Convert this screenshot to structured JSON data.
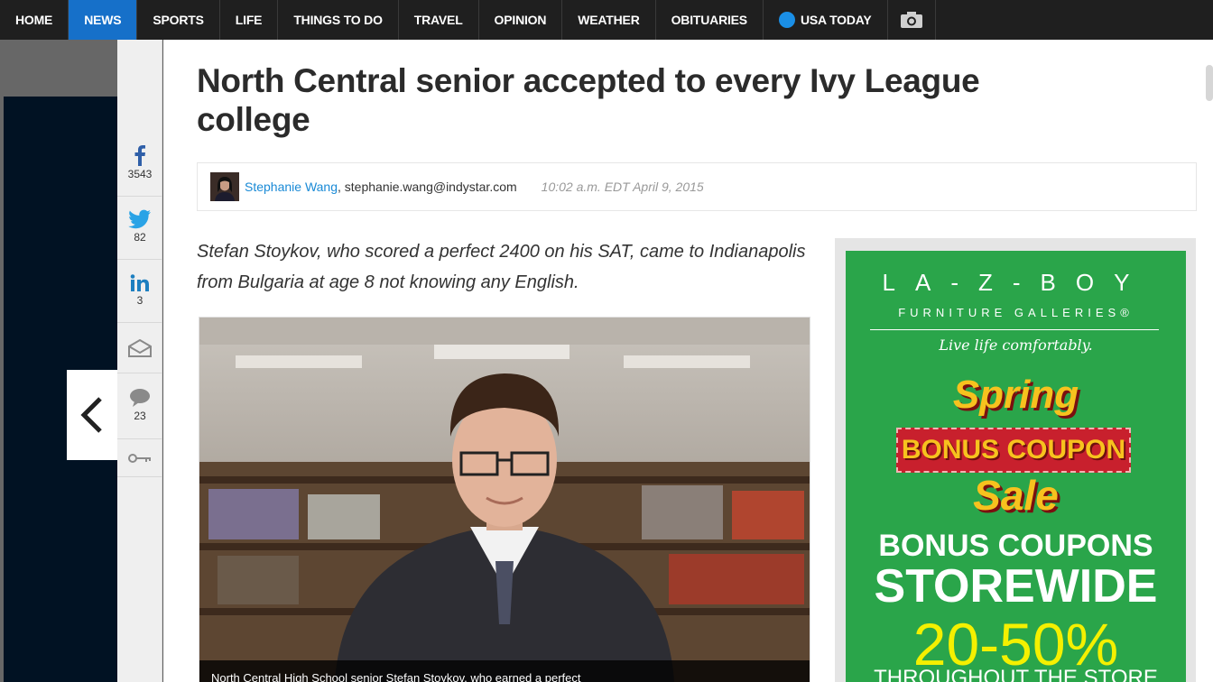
{
  "nav": {
    "items": [
      "HOME",
      "NEWS",
      "SPORTS",
      "LIFE",
      "THINGS TO DO",
      "TRAVEL",
      "OPINION",
      "WEATHER",
      "OBITUARIES"
    ],
    "active": "NEWS",
    "usa_today": "USA TODAY",
    "camera_icon": "camera-icon"
  },
  "share": {
    "facebook_count": "3543",
    "twitter_count": "82",
    "linkedin_count": "3",
    "comments_count": "23",
    "icons": [
      "facebook-icon",
      "twitter-icon",
      "linkedin-icon",
      "email-icon",
      "comment-icon",
      "key-icon"
    ]
  },
  "article": {
    "headline": "North Central senior accepted to every Ivy League college",
    "author": "Stephanie Wang",
    "email": ", stephanie.wang@indystar.com",
    "timestamp": "10:02 a.m. EDT April 9, 2015",
    "summary": "Stefan Stoykov, who scored a perfect 2400 on his SAT, came to Indianapolis from Bulgaria at age 8 not knowing any English.",
    "caption": "North Central High School senior Stefan Stoykov, who earned a perfect"
  },
  "ad": {
    "brand": "LA-Z-BOY",
    "galleries": "FURNITURE GALLERIES®",
    "tagline": "Live life comfortably.",
    "spring": "Spring",
    "ribbon": "BONUS COUPON",
    "sale": "Sale",
    "bonus": "BONUS COUPONS",
    "storewide": "STOREWIDE",
    "percent": "20-50%",
    "throughout": "THROUGHOUT THE STORE"
  },
  "colors": {
    "nav_bg": "#1f1f1f",
    "nav_active": "#1670c9",
    "link": "#1a8ad6",
    "ad_green": "#2aa54a",
    "ad_yellow": "#f7c21e",
    "ad_red": "#c8202d"
  }
}
